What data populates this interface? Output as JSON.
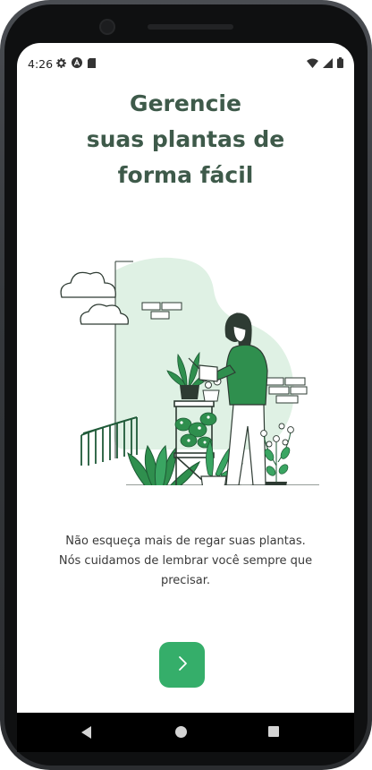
{
  "status_bar": {
    "time": "4:26",
    "left_icons": [
      "gear-icon",
      "a-circle-icon",
      "sd-card-icon"
    ],
    "right_icons": [
      "wifi-icon",
      "signal-icon",
      "battery-icon"
    ]
  },
  "onboarding": {
    "title_lines": [
      "Gerencie",
      "suas plantas de",
      "forma fácil"
    ],
    "description": "Não esqueça mais de regar suas plantas. Nós cuidamos de lembrar você sempre que precisar.",
    "illustration": "woman-watering-plants-illustration",
    "next_button_icon": "chevron-right-icon"
  },
  "nav_bar": {
    "buttons": [
      "back-icon",
      "home-icon",
      "recents-icon"
    ]
  },
  "colors": {
    "title": "#3e5a4a",
    "accent": "#35ae6a",
    "illustration_green": "#2f8f4e",
    "illustration_tint": "#dff1e4"
  }
}
